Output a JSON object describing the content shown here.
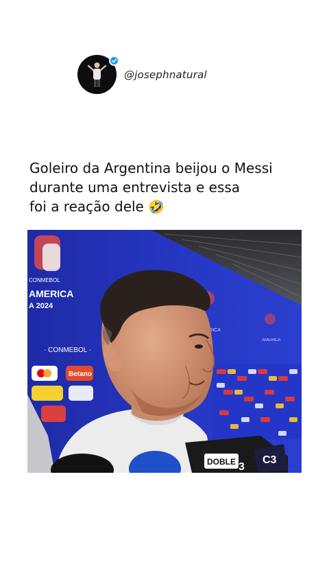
{
  "post": {
    "username": "@josephnatural",
    "verified": true,
    "caption_lines": [
      "Goleiro da Argentina beijou o Messi",
      "durante uma entrevista e essa",
      "foi a reação dele"
    ],
    "caption_emoji": "🤣"
  },
  "media": {
    "backdrop_texts": {
      "america": "AMERICA",
      "conmebol_small": "CONMEBOL",
      "year": "A 2024",
      "conmebol": "· CONMEBOL ·",
      "betano": "Betano",
      "doble": "DOBLE",
      "num": "3",
      "c3": "C3"
    },
    "colors": {
      "backdrop": "#2330b8",
      "sponsor_red": "#e03a3a"
    }
  }
}
